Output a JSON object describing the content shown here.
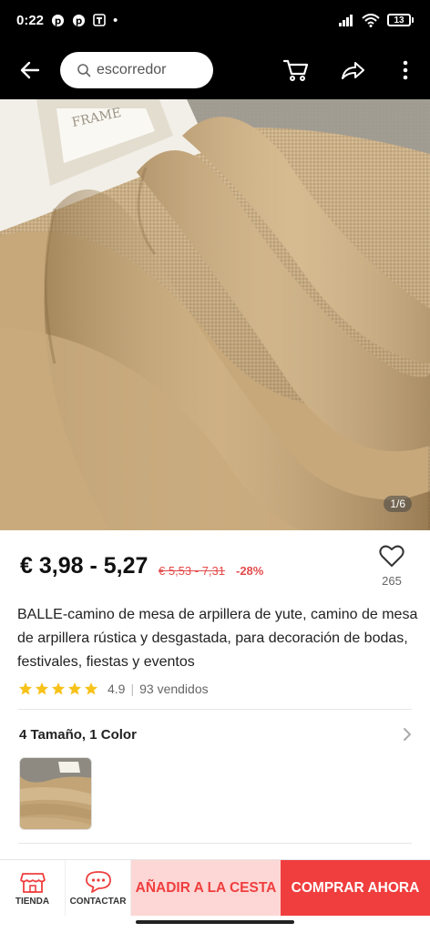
{
  "status_bar": {
    "time": "0:22",
    "battery": "13",
    "dot": "•",
    "icons": [
      "pinterest-icon",
      "pinterest-icon",
      "app-notification-icon",
      "signal-icon",
      "wifi-icon",
      "battery-icon"
    ]
  },
  "top_bar": {
    "search_query": "escorredor",
    "icons": [
      "back-arrow-icon",
      "search-icon",
      "cart-icon",
      "share-icon",
      "more-vertical-icon"
    ]
  },
  "gallery": {
    "counter": "1/6"
  },
  "product": {
    "price": "€ 3,98 - 5,27",
    "old_price": "€ 5,53 - 7,31",
    "discount": "-28%",
    "wishlist_count": "265",
    "title": "BALLE-camino de mesa de arpillera de yute, camino de mesa de arpillera rústica y desgastada, para decoración de bodas, festivales, fiestas y eventos",
    "rating": "4.9",
    "rating_stars": 5,
    "separator": "|",
    "sold": "93 vendidos",
    "variants_label": "4 Tamaño, 1 Color"
  },
  "bottom_bar": {
    "store_label": "TIENDA",
    "contact_label": "CONTACTAR",
    "add_to_cart": "AÑADIR A LA CESTA",
    "buy_now": "COMPRAR AHORA"
  },
  "colors": {
    "accent": "#f03e3e",
    "accent_light": "#fdd7d6",
    "star": "#f7c21a",
    "burlap": "#c9ab80"
  }
}
